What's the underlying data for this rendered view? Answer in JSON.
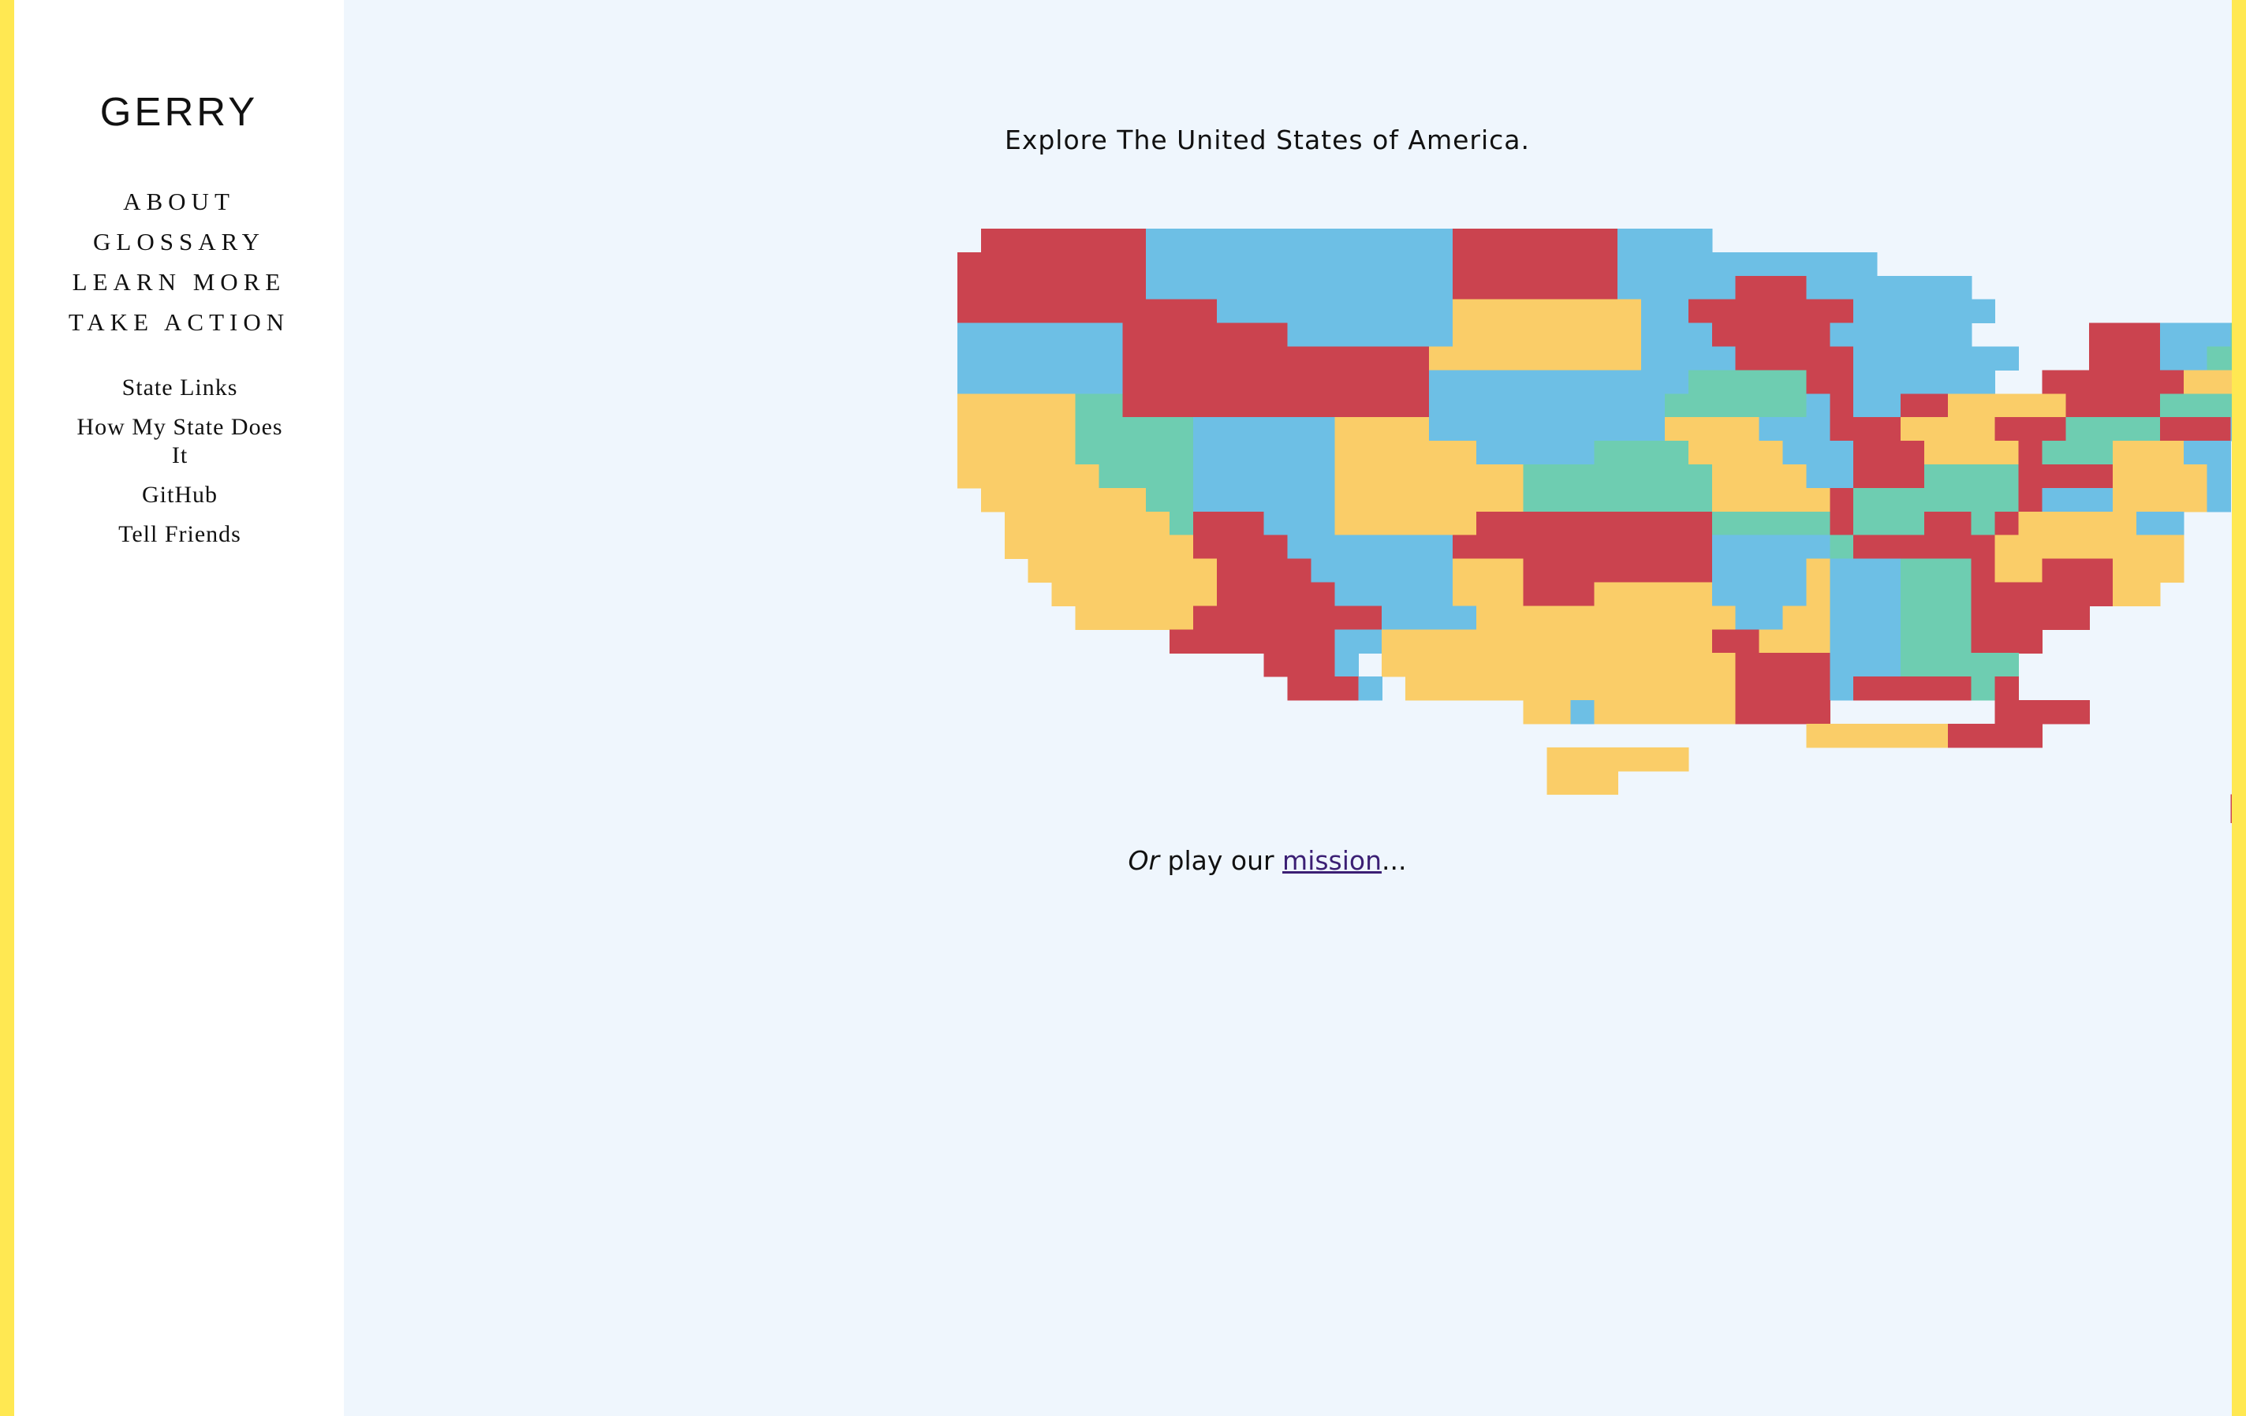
{
  "app": {
    "brand": "GERRY"
  },
  "nav": {
    "main": [
      "ABOUT",
      "GLOSSARY",
      "LEARN MORE",
      "TAKE ACTION"
    ],
    "secondary": [
      "State Links",
      "How My State Does It",
      "GitHub",
      "Tell Friends"
    ]
  },
  "main": {
    "headline": "Explore The United States of America.",
    "mission_prefix": "Or",
    "mission_middle": " play our ",
    "mission_link": "mission",
    "mission_suffix": "..."
  },
  "colors": {
    "frame": "#ffe852",
    "sidebar": "#ffffff",
    "background": "#eff6fd",
    "red": "#cb434f",
    "blue": "#6dbfe5",
    "yellow": "#facd68",
    "green": "#6ecdb1",
    "link": "#3b1f74"
  },
  "map": {
    "legend": {
      "R": "red",
      "B": "blue",
      "Y": "yellow",
      "G": "green"
    },
    "rows": [
      ".RRRRRRRBBBBBBBBBBBBBRRRRRRRBBBB..........................",
      "RRRRRRRRBBBBBBBBBBBBBRRRRRRRBBBBBBBBBBB...................",
      "RRRRRRRRBBBBBBBBBBBBBRRRRRRRBBBBBRRRBBBBBBB.............RRR",
      "RRRRRRRRRRRBBBBBBBBBBYYYYYYYYBBRRRRRRRBBBBBB............RRRR",
      "BBBBBBBRRRRRRRBBBBBBBYYYYYYYYBBBRRRRRBBBBBB.....RRRBBBGRRRR",
      "BBBBBBBRRRRRRRRRRRRRYYYYYYYYYBBBBRRRRRBBBBBBB...RRRBBGGRRRR",
      "BBBBBBBRRRRRRRRRRRRRBBBBBBBBBBBGGGGGRRBBBBBB..RRRRRRYYYYYY.",
      "YYYYYGGRRRRRRRRRRRRRBBBBBBBBBBGGGGGGBRBBRRYYYYYRRRRGGGGBRBY",
      "YYYYYGGGGGBBBBBBYYYYBBBBBBBBBBYYYYBBBRRRYYYYRRRGGGGRRRBBY..",
      "YYYYYGGGGGBBBBBBYYYYYYBBBBBGGGGYYYYBBBRRRYYYYRGGGYYYBB.....",
      "YYYYYYGGGGBBBBBBYYYYYYYYGGGGGGGGYYYYBBRRRGGGGRRRRYYYYB.....",
      ".YYYYYYYGGBBBBBBYYYYYYYYGGGGGGGGYYYYYRGGGGGGGRBBBYYYYB.....",
      "..YYYYYYYGRRRBBBYYYYYYRRRRRRRRRRGGGGGRGGGRRGRYYYYYBB.......",
      "..YYYYYYYYRRRRBBBBBBBRRRRRRRRRRRBBBBBGRRRRRRYYYYYYYY.......",
      "...YYYYYYYYRRRRBBBBBBYYYRRRRRRRRBBBBYBBBGGGRYYRRRYYY.......",
      "....YYYYYYYRRRRRBBBBBYYYRRRYYYYYBBBBYBBBGGGRRRRRRYY........",
      ".....YYYYYRRRRRRRRBBBBYYYYYYYYYYYBBYYBBBGGGRRRRR...........",
      ".........RRRRRRRBBYYYYYYYYYYYYYYRRYYYBBBGGGRRR.............",
      ".............RRRB.YYYYYYYYYYYYYYYRRRRBBBGGGGG..............",
      "..............RRRB.YYYYYYYYYYYYYYRRRRBRRRRRGR..............",
      "........................YYBYYYYYYRRRR.......RRRR...........",
      "....................................YYYYYYRRRR...........",
      ".........................YYYYYY.........................RRRR..",
      ".........................YYY............................RRRR..",
      "......................................................RRRR..",
      "......................................................RRRR..",
      ".....................................................RRRRR.."
    ]
  }
}
